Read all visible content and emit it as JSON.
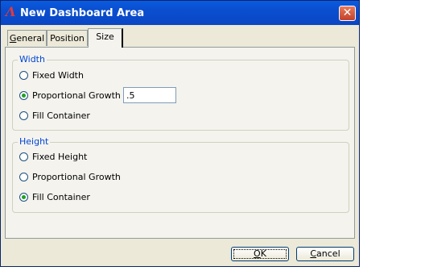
{
  "window": {
    "title": "New Dashboard Area",
    "close_symbol": "✕"
  },
  "tabs": [
    {
      "label_first": "G",
      "label_rest": "eneral"
    },
    {
      "label": "Position"
    },
    {
      "label": "Size"
    }
  ],
  "width_group": {
    "title": "Width",
    "options": [
      {
        "label": "Fixed Width",
        "selected": false
      },
      {
        "label": "Proportional Growth",
        "selected": true
      },
      {
        "label": "Fill Container",
        "selected": false
      }
    ],
    "proportional_value": ".5"
  },
  "height_group": {
    "title": "Height",
    "options": [
      {
        "label": "Fixed Height",
        "selected": false
      },
      {
        "label": "Proportional Growth",
        "selected": false
      },
      {
        "label": "Fill Container",
        "selected": true
      }
    ]
  },
  "buttons": {
    "ok_first": "O",
    "ok_rest": "K",
    "cancel_first": "C",
    "cancel_rest": "ancel"
  }
}
